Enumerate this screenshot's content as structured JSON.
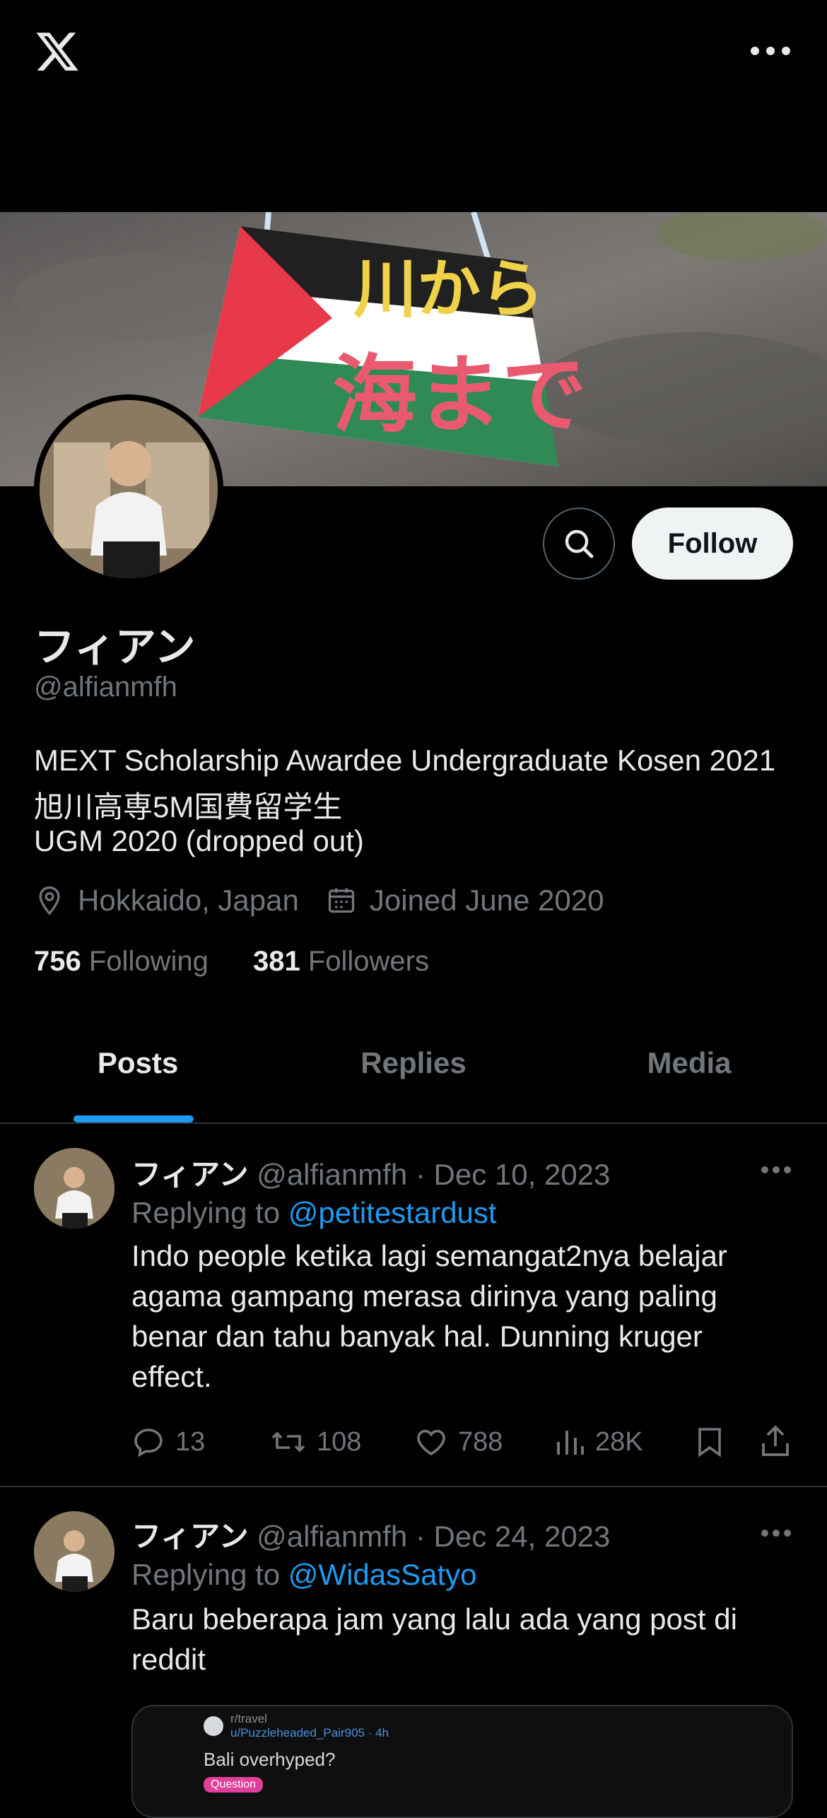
{
  "profile": {
    "display_name": "フィアン",
    "handle": "@alfianmfh",
    "bio": [
      "MEXT Scholarship Awardee Undergraduate Kosen 2021",
      "旭川高専5M国費留学生",
      "UGM 2020 (dropped out)"
    ],
    "location": "Hokkaido, Japan",
    "joined": "Joined June 2020",
    "following_count": "756",
    "following_label": "Following",
    "followers_count": "381",
    "followers_label": "Followers",
    "follow_label": "Follow"
  },
  "tabs": [
    {
      "label": "Posts",
      "active": true
    },
    {
      "label": "Replies",
      "active": false
    },
    {
      "label": "Media",
      "active": false
    }
  ],
  "tweets": [
    {
      "name": "フィアン",
      "handle": "@alfianmfh",
      "date": "· Dec 10, 2023",
      "replying_prefix": "Replying to",
      "replying_to": "@petitestardust",
      "text_lines": [
        "Indo people ketika lagi semangat2nya belajar",
        "agama gampang merasa dirinya yang paling",
        "benar dan tahu banyak hal. Dunning kruger",
        "effect."
      ],
      "replies": "13",
      "reposts": "108",
      "likes": "788",
      "views": "28K"
    },
    {
      "name": "フィアン",
      "handle": "@alfianmfh",
      "date": "· Dec 24, 2023",
      "replying_prefix": "Replying to",
      "replying_to": "@WidasSatyo",
      "text_lines": [
        "Baru beberapa jam yang lalu ada yang post di",
        "reddit"
      ],
      "card": {
        "subreddit": "r/travel",
        "user": "u/Puzzleheaded_Pair905 · 4h",
        "title": "Bali overhyped?",
        "flair": "Question"
      }
    }
  ],
  "banner_sign": {
    "line1": "川から",
    "line2": "海まで"
  },
  "colors": {
    "accent": "#1d9bf0",
    "muted": "#71767b",
    "text": "#e7e9ea",
    "divider": "#2f3336"
  },
  "icons": [
    "x-logo-icon",
    "more-icon",
    "search-icon",
    "location-icon",
    "calendar-icon",
    "reply-icon",
    "repost-icon",
    "like-icon",
    "views-icon",
    "bookmark-icon",
    "share-icon"
  ]
}
